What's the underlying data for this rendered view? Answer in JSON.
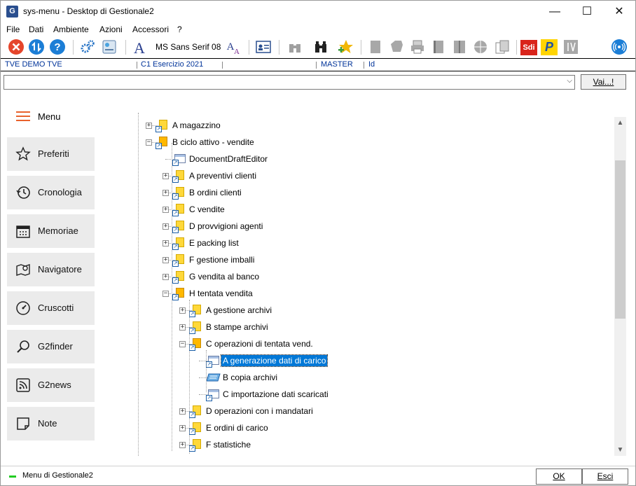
{
  "window": {
    "title": "sys-menu - Desktop di Gestionale2",
    "app_icon_letter": "G",
    "minimize_glyph": "—",
    "maximize_glyph": "☐",
    "close_glyph": "✕"
  },
  "menubar": {
    "items": [
      "File",
      "Dati",
      "Ambiente",
      "Azioni",
      "Accessori",
      "?"
    ]
  },
  "toolbar": {
    "font_label": "MS Sans Serif 08",
    "icons": [
      "stop-icon",
      "sync-icon",
      "help-icon",
      "settings-gears-icon",
      "config-icon",
      "font-a-icon",
      "font-size-icon",
      "user-card-icon",
      "binoculars-grey-icon",
      "binoculars-icon",
      "star-add-icon",
      "doc-grey-icon",
      "shape-grey-icon",
      "printer-icon",
      "book-icon",
      "book2-icon",
      "globe-icon",
      "copy-icon",
      "sdi-icon",
      "p-icon",
      "iv-icon",
      "wireless-icon"
    ],
    "sdi_text": "Sdi",
    "p_text": "P"
  },
  "statusbar": {
    "company": "TVE DEMO TVE",
    "exercise": "C1 Esercizio 2021",
    "user": "MASTER",
    "id": "Id"
  },
  "command": {
    "value": "",
    "go_label": "Vai...!"
  },
  "sidebar": {
    "menu_label": "Menu",
    "items": [
      {
        "label": "Preferiti",
        "icon": "star-icon"
      },
      {
        "label": "Cronologia",
        "icon": "history-icon"
      },
      {
        "label": "Memoriae",
        "icon": "calendar-icon"
      },
      {
        "label": "Navigatore",
        "icon": "map-pin-icon"
      },
      {
        "label": "Cruscotti",
        "icon": "gauge-icon"
      },
      {
        "label": "G2finder",
        "icon": "search-icon"
      },
      {
        "label": "G2news",
        "icon": "rss-icon"
      },
      {
        "label": "Note",
        "icon": "note-icon"
      }
    ]
  },
  "tree": {
    "nodes": [
      {
        "label": "A magazzino",
        "level": 0,
        "type": "folder",
        "expanded": false
      },
      {
        "label": "B ciclo attivo - vendite",
        "level": 0,
        "type": "folder",
        "expanded": true
      },
      {
        "label": "DocumentDraftEditor",
        "level": 1,
        "type": "form"
      },
      {
        "label": "A preventivi clienti",
        "level": 1,
        "type": "folder",
        "expanded": false
      },
      {
        "label": "B ordini clienti",
        "level": 1,
        "type": "folder",
        "expanded": false
      },
      {
        "label": "C vendite",
        "level": 1,
        "type": "folder",
        "expanded": false
      },
      {
        "label": "D provvigioni agenti",
        "level": 1,
        "type": "folder",
        "expanded": false
      },
      {
        "label": "E packing list",
        "level": 1,
        "type": "folder",
        "expanded": false
      },
      {
        "label": "F gestione imballi",
        "level": 1,
        "type": "folder",
        "expanded": false
      },
      {
        "label": "G vendita al banco",
        "level": 1,
        "type": "folder",
        "expanded": false
      },
      {
        "label": "H tentata vendita",
        "level": 1,
        "type": "folder",
        "expanded": true
      },
      {
        "label": "A gestione archivi",
        "level": 2,
        "type": "folder",
        "expanded": false
      },
      {
        "label": "B stampe archivi",
        "level": 2,
        "type": "folder",
        "expanded": false
      },
      {
        "label": "C operazioni di tentata vend.",
        "level": 2,
        "type": "folder",
        "expanded": true
      },
      {
        "label": "A generazione dati di carico",
        "level": 3,
        "type": "form",
        "selected": true
      },
      {
        "label": "B copia archivi",
        "level": 3,
        "type": "copy"
      },
      {
        "label": "C importazione dati scaricati",
        "level": 3,
        "type": "form"
      },
      {
        "label": "D operazioni con i mandatari",
        "level": 2,
        "type": "folder",
        "expanded": false
      },
      {
        "label": "E ordini di carico",
        "level": 2,
        "type": "folder",
        "expanded": false
      },
      {
        "label": "F statistiche",
        "level": 2,
        "type": "folder",
        "expanded": false
      }
    ]
  },
  "footer": {
    "label": "Menu di Gestionale2",
    "ok_label": "OK",
    "cancel_label": "Esci",
    "status_color": "#22cc22"
  },
  "colors": {
    "selection": "#0078d7",
    "status_text": "#003399",
    "menu_accent": "#e8622c"
  }
}
